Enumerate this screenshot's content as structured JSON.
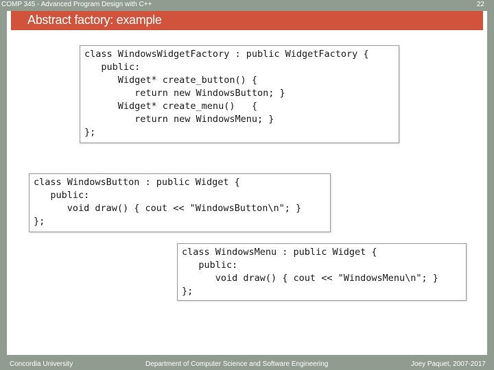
{
  "header": {
    "course": "COMP 345 - Advanced Program Design with C++",
    "slide_number": "22"
  },
  "title": "Abstract factory: example",
  "code_blocks": {
    "factory": [
      "class WindowsWidgetFactory : public WidgetFactory {",
      "   public:",
      "      Widget* create_button() {",
      "         return new WindowsButton; }",
      "      Widget* create_menu()   {",
      "         return new WindowsMenu; }",
      "};"
    ],
    "button": [
      "class WindowsButton : public Widget {",
      "   public:",
      "      void draw() { cout << \"WindowsButton\\n\"; }",
      "};"
    ],
    "menu": [
      "class WindowsMenu : public Widget {",
      "   public:",
      "      void draw() { cout << \"WindowsMenu\\n\"; }",
      "};"
    ]
  },
  "footer": {
    "left": "Concordia University",
    "center": "Department of Computer Science and Software Engineering",
    "right": "Joey Paquet, 2007-2017"
  },
  "colors": {
    "frame": "#8f9c8f",
    "title_bar": "#d2533b",
    "code_text": "#1c1c1c"
  }
}
